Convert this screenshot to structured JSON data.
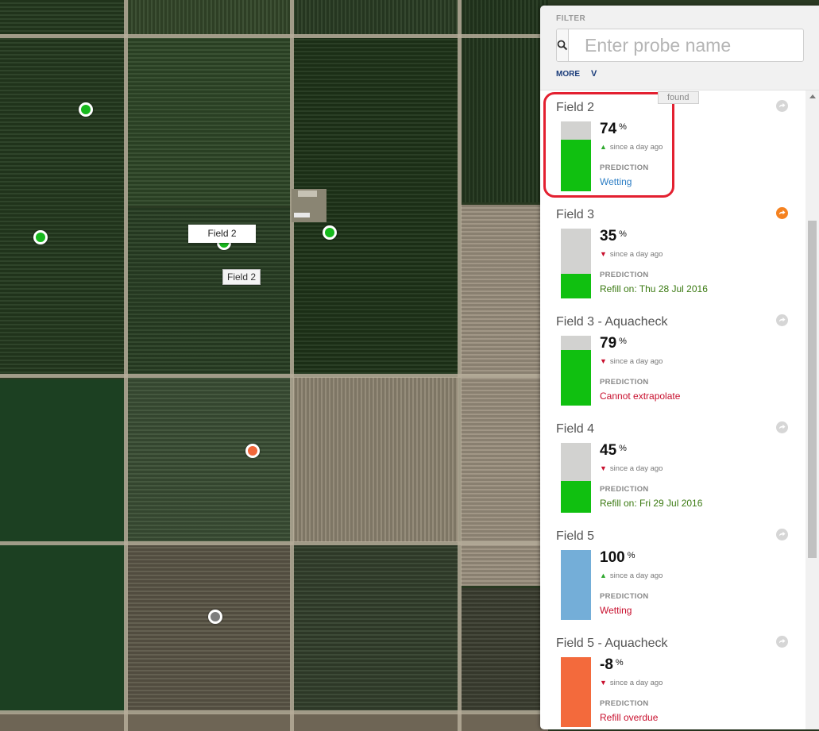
{
  "map": {
    "markers": [
      {
        "id": "m1",
        "status": "green"
      },
      {
        "id": "m2",
        "status": "green"
      },
      {
        "id": "m3",
        "status": "green"
      },
      {
        "id": "m4",
        "status": "green"
      },
      {
        "id": "m5",
        "status": "orange"
      },
      {
        "id": "m6",
        "status": "gray"
      }
    ],
    "selected_label": "Field 2",
    "hover_tooltip": "Field 2"
  },
  "filter": {
    "label": "FILTER",
    "search_placeholder": "Enter probe name",
    "search_value": "",
    "more_label": "MORE",
    "more_chevron": "V",
    "search_icon": "search-icon"
  },
  "results": {
    "found_label": "found"
  },
  "colors": {
    "moisture_green": "#10c010",
    "moisture_blue": "#74aed8",
    "moisture_orange": "#f36a3c",
    "bar_empty": "#d2d2d0",
    "trend_up": "#2fa82f",
    "trend_down": "#c8102e",
    "pred_blue": "#2d7ec5",
    "pred_green": "#3b7a12",
    "pred_red": "#c8102e",
    "highlight": "#e32030"
  },
  "probes": [
    {
      "name": "Field 2",
      "value": "74",
      "unit": "%",
      "moisture_fraction": 0.74,
      "fill": "green",
      "trend": "up",
      "trend_text": "since a day ago",
      "prediction_label": "PREDICTION",
      "prediction": "Wetting",
      "prediction_color": "blue",
      "action_icon": "refresh-icon",
      "action_state": "idle",
      "highlighted": true
    },
    {
      "name": "Field 3",
      "value": "35",
      "unit": "%",
      "moisture_fraction": 0.35,
      "fill": "green",
      "trend": "down",
      "trend_text": "since a day ago",
      "prediction_label": "PREDICTION",
      "prediction": "Refill on: Thu 28 Jul 2016",
      "prediction_color": "green",
      "action_icon": "refresh-icon",
      "action_state": "active",
      "highlighted": false
    },
    {
      "name": "Field 3 - Aquacheck",
      "value": "79",
      "unit": "%",
      "moisture_fraction": 0.79,
      "fill": "green",
      "trend": "down",
      "trend_text": "since a day ago",
      "prediction_label": "PREDICTION",
      "prediction": "Cannot extrapolate",
      "prediction_color": "red",
      "action_icon": "refresh-icon",
      "action_state": "idle",
      "highlighted": false
    },
    {
      "name": "Field 4",
      "value": "45",
      "unit": "%",
      "moisture_fraction": 0.45,
      "fill": "green",
      "trend": "down",
      "trend_text": "since a day ago",
      "prediction_label": "PREDICTION",
      "prediction": "Refill on: Fri 29 Jul 2016",
      "prediction_color": "green",
      "action_icon": "refresh-icon",
      "action_state": "idle",
      "highlighted": false
    },
    {
      "name": "Field 5",
      "value": "100",
      "unit": "%",
      "moisture_fraction": 1.0,
      "fill": "blue",
      "trend": "up",
      "trend_text": "since a day ago",
      "prediction_label": "PREDICTION",
      "prediction": "Wetting",
      "prediction_color": "red",
      "action_icon": "refresh-icon",
      "action_state": "idle",
      "highlighted": false
    },
    {
      "name": "Field 5 - Aquacheck",
      "value": "-8",
      "unit": "%",
      "moisture_fraction": 1.0,
      "fill": "orange",
      "trend": "down",
      "trend_text": "since a day ago",
      "prediction_label": "PREDICTION",
      "prediction": "Refill overdue",
      "prediction_color": "red",
      "action_icon": "refresh-icon",
      "action_state": "idle",
      "highlighted": false
    }
  ]
}
